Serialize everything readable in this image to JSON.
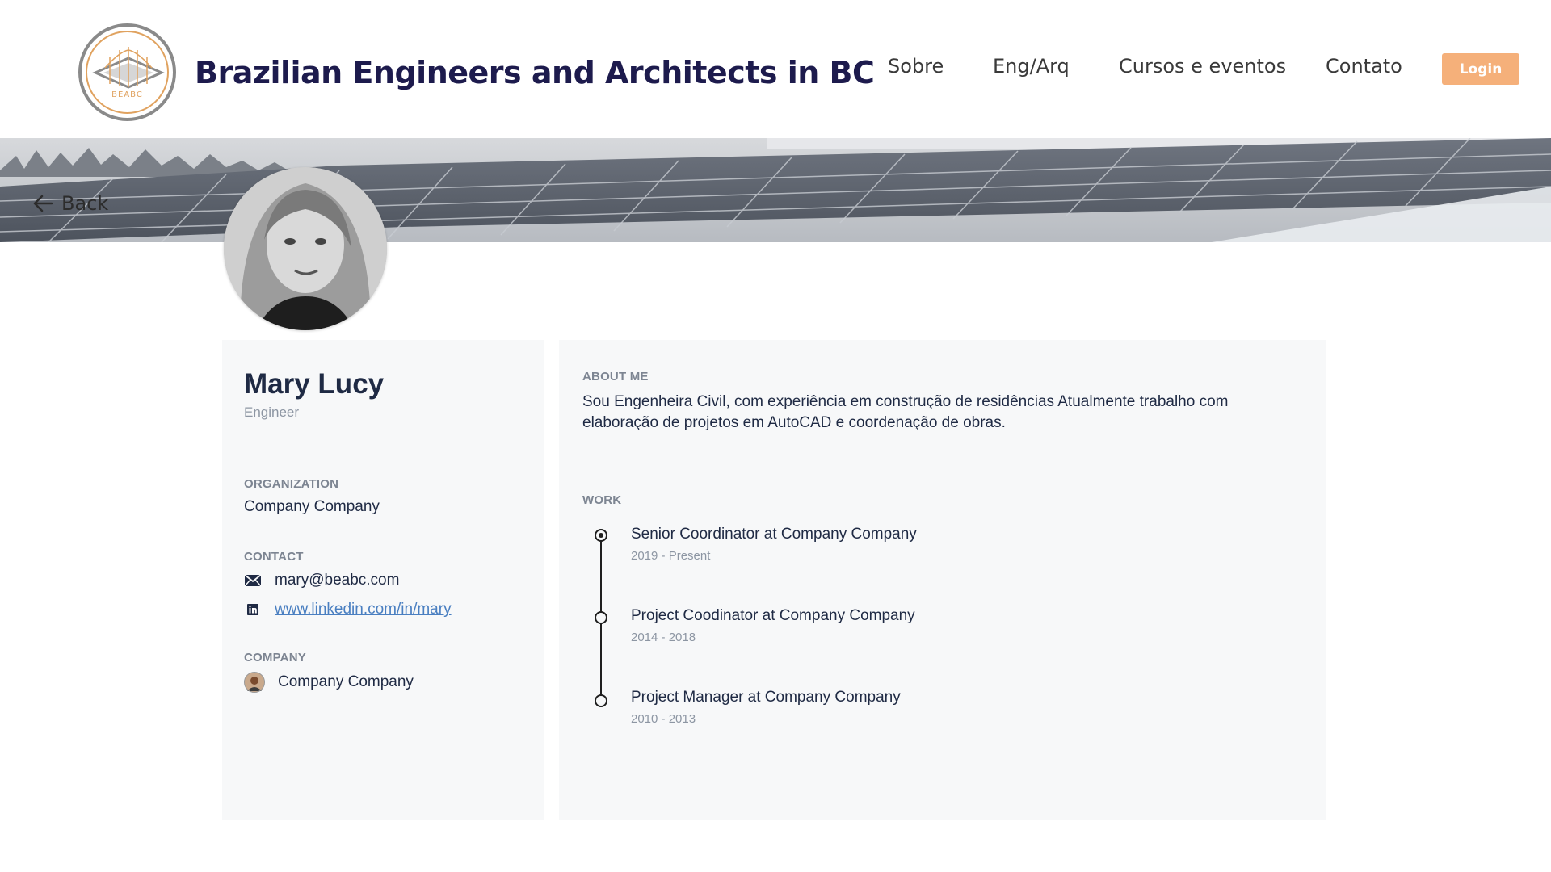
{
  "header": {
    "site_title": "Brazilian Engineers and Architects in BC",
    "logo_text": "BEABC",
    "nav": [
      "Sobre",
      "Eng/Arq",
      "Cursos e eventos",
      "Contato"
    ],
    "login_label": "Login"
  },
  "back_label": "Back",
  "profile": {
    "name": "Mary Lucy",
    "role": "Engineer",
    "organization_label": "ORGANIZATION",
    "organization": "Company Company",
    "contact_label": "CONTACT",
    "email": "mary@beabc.com",
    "linkedin": "www.linkedin.com/in/mary",
    "company_label": "COMPANY",
    "company": "Company Company"
  },
  "about": {
    "label": "ABOUT ME",
    "text": "Sou Engenheira Civil, com experiência em construção de residências  Atualmente trabalho com elaboração de projetos em AutoCAD e coordenação de obras."
  },
  "work": {
    "label": "WORK",
    "items": [
      {
        "title": "Senior  Coordinator at Company Company",
        "dates": "2019 - Present"
      },
      {
        "title": "Project Coodinator at Company Company",
        "dates": "2014 - 2018"
      },
      {
        "title": "Project Manager at Company Company",
        "dates": "2010 - 2013"
      }
    ]
  },
  "colors": {
    "accent": "#f5b07a",
    "title": "#1d1b4d",
    "link": "#4a7fc1",
    "card_bg": "#f7f8f9"
  }
}
